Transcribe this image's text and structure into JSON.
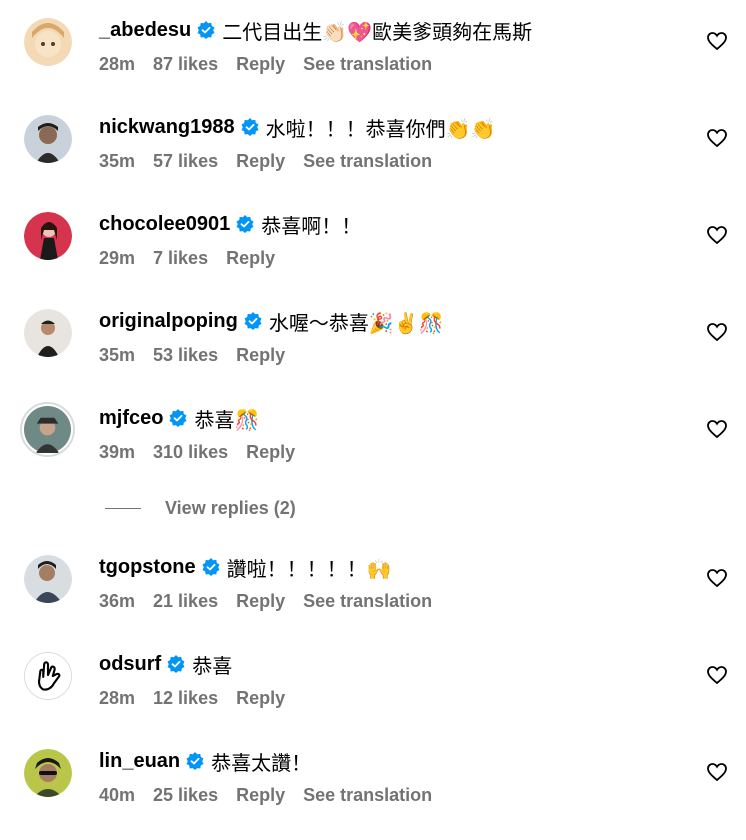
{
  "comments": [
    {
      "user": "_abedesu",
      "text": "二代目出生👏🏻💖歐美爹頭夠在馬斯",
      "time": "28m",
      "likes": "87 likes",
      "reply": "Reply",
      "translate": "See translation"
    },
    {
      "user": "nickwang1988",
      "text": "水啦！！！恭喜你們👏👏",
      "time": "35m",
      "likes": "57 likes",
      "reply": "Reply",
      "translate": "See translation"
    },
    {
      "user": "chocolee0901",
      "text": "恭喜啊！！",
      "time": "29m",
      "likes": "7 likes",
      "reply": "Reply",
      "translate": ""
    },
    {
      "user": "originalpoping",
      "text": "水喔～恭喜🎉✌️🎊",
      "time": "35m",
      "likes": "53 likes",
      "reply": "Reply",
      "translate": ""
    },
    {
      "user": "mjfceo",
      "text": "恭喜🎊",
      "time": "39m",
      "likes": "310 likes",
      "reply": "Reply",
      "translate": ""
    },
    {
      "user": "tgopstone",
      "text": "讚啦！！！！！🙌",
      "time": "36m",
      "likes": "21 likes",
      "reply": "Reply",
      "translate": "See translation"
    },
    {
      "user": "odsurf",
      "text": "恭喜",
      "time": "28m",
      "likes": "12 likes",
      "reply": "Reply",
      "translate": ""
    },
    {
      "user": "lin_euan",
      "text": "恭喜太讚！",
      "time": "40m",
      "likes": "25 likes",
      "reply": "Reply",
      "translate": "See translation"
    }
  ],
  "view_replies": "View replies (2)",
  "colors": {
    "verified": "#0095f6",
    "secondary": "#737373"
  }
}
